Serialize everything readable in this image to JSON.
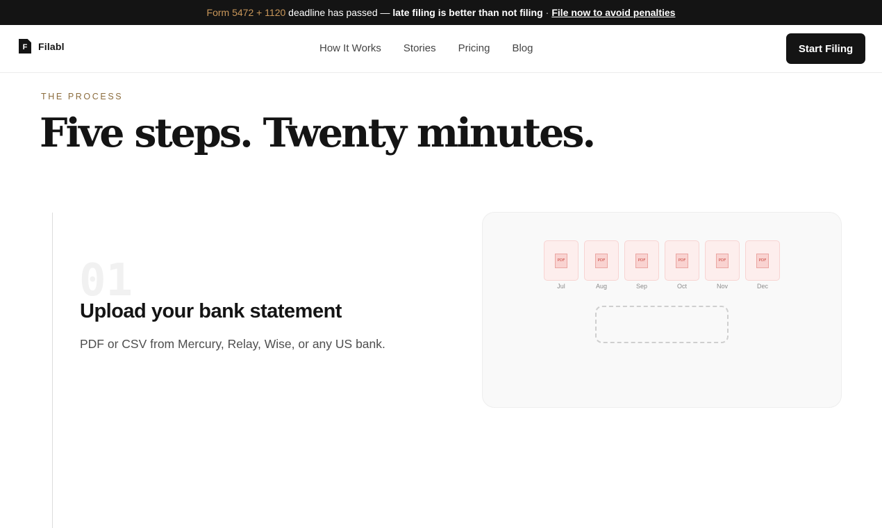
{
  "banner": {
    "form_text": "Form 5472 + 1120",
    "middle_text": " deadline has passed — ",
    "bold_text": "late filing is better than not filing",
    "separator": "·",
    "link_text": "File now to avoid penalties"
  },
  "nav": {
    "logo_letter": "F",
    "logo_text": "Filabl",
    "links": [
      "How It Works",
      "Stories",
      "Pricing",
      "Blog"
    ],
    "cta_label": "Start Filing"
  },
  "hero": {
    "eyebrow": "THE PROCESS",
    "headline": "Five steps. Twenty minutes."
  },
  "step": {
    "number": "01",
    "title": "Upload your bank statement",
    "description": "PDF or CSV from Mercury, Relay, Wise, or any US bank."
  },
  "illustration": {
    "file_badge": "PDF",
    "months": [
      "Jul",
      "Aug",
      "Sep",
      "Oct",
      "Nov",
      "Dec"
    ]
  },
  "colors": {
    "banner_bg": "#141414",
    "accent": "#c9975a",
    "eyebrow": "#8b6b3c",
    "file_tile": "#fdeeed"
  }
}
